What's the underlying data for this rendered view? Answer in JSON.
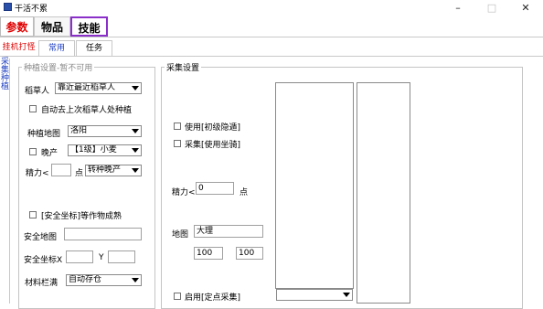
{
  "window": {
    "title": "干活不累"
  },
  "top_tabs": [
    "参数",
    "物品",
    "技能"
  ],
  "sub_tabs": [
    "挂机打怪",
    "常用",
    "任务"
  ],
  "side_tab": "采集种植",
  "planting": {
    "legend": "种植设置-暂不可用",
    "scarecrow_label": "稻草人",
    "scarecrow_value": "靠近最近稻草人",
    "auto_last_scarecrow": "自动去上次稻草人处种植",
    "map_label": "种植地图",
    "map_value": "洛阳",
    "late_label": "晚产",
    "late_value": "【1级】小麦",
    "energy_prefix": "精力<",
    "energy_suffix": "点",
    "energy_action": "转种晚产",
    "safe_coord_check": "[安全坐标]等作物成熟",
    "safe_map_label": "安全地图",
    "safe_coord_label": "安全坐标X",
    "y_label": "Y",
    "material_full_label": "材料栏满",
    "material_full_value": "自动存仓"
  },
  "gathering": {
    "legend": "采集设置",
    "use_beginner_nav": "使用[初级隐遁]",
    "gather_use_mount": "采集[使用坐骑]",
    "energy_prefix": "精力<",
    "energy_value": "0",
    "energy_suffix": "点",
    "map_label": "地图",
    "map_value": "大理",
    "coord_x": "100",
    "coord_y": "100",
    "fixed_point_gather": "启用[定点采集]"
  }
}
